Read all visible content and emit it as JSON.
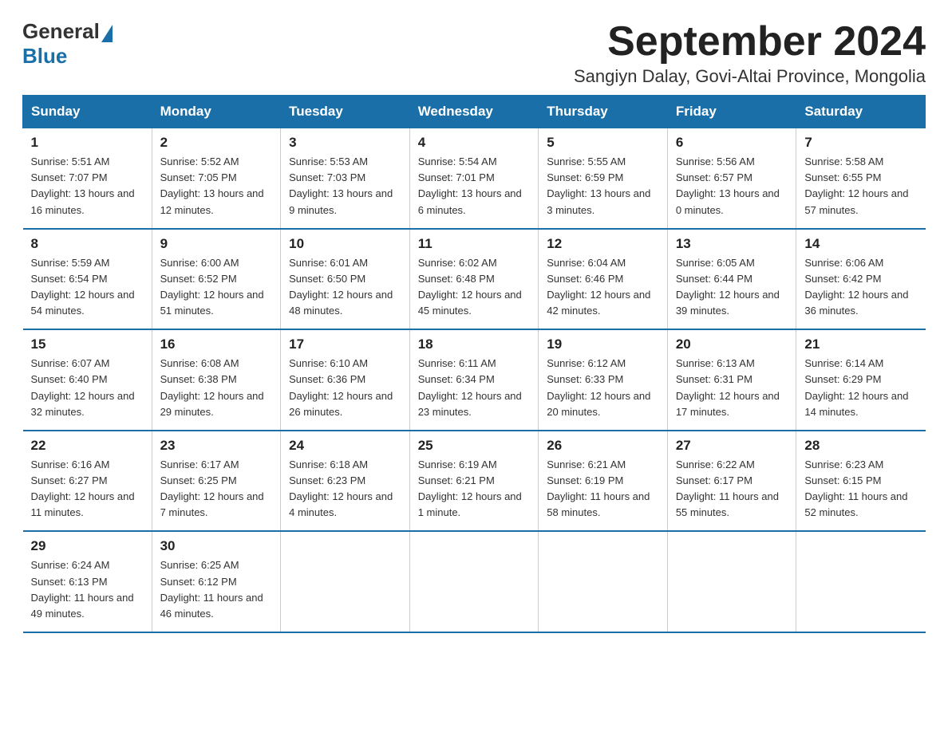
{
  "logo": {
    "general": "General",
    "blue": "Blue"
  },
  "header": {
    "month_year": "September 2024",
    "location": "Sangiyn Dalay, Govi-Altai Province, Mongolia"
  },
  "days_of_week": [
    "Sunday",
    "Monday",
    "Tuesday",
    "Wednesday",
    "Thursday",
    "Friday",
    "Saturday"
  ],
  "weeks": [
    [
      {
        "day": "1",
        "sunrise": "5:51 AM",
        "sunset": "7:07 PM",
        "daylight": "13 hours and 16 minutes."
      },
      {
        "day": "2",
        "sunrise": "5:52 AM",
        "sunset": "7:05 PM",
        "daylight": "13 hours and 12 minutes."
      },
      {
        "day": "3",
        "sunrise": "5:53 AM",
        "sunset": "7:03 PM",
        "daylight": "13 hours and 9 minutes."
      },
      {
        "day": "4",
        "sunrise": "5:54 AM",
        "sunset": "7:01 PM",
        "daylight": "13 hours and 6 minutes."
      },
      {
        "day": "5",
        "sunrise": "5:55 AM",
        "sunset": "6:59 PM",
        "daylight": "13 hours and 3 minutes."
      },
      {
        "day": "6",
        "sunrise": "5:56 AM",
        "sunset": "6:57 PM",
        "daylight": "13 hours and 0 minutes."
      },
      {
        "day": "7",
        "sunrise": "5:58 AM",
        "sunset": "6:55 PM",
        "daylight": "12 hours and 57 minutes."
      }
    ],
    [
      {
        "day": "8",
        "sunrise": "5:59 AM",
        "sunset": "6:54 PM",
        "daylight": "12 hours and 54 minutes."
      },
      {
        "day": "9",
        "sunrise": "6:00 AM",
        "sunset": "6:52 PM",
        "daylight": "12 hours and 51 minutes."
      },
      {
        "day": "10",
        "sunrise": "6:01 AM",
        "sunset": "6:50 PM",
        "daylight": "12 hours and 48 minutes."
      },
      {
        "day": "11",
        "sunrise": "6:02 AM",
        "sunset": "6:48 PM",
        "daylight": "12 hours and 45 minutes."
      },
      {
        "day": "12",
        "sunrise": "6:04 AM",
        "sunset": "6:46 PM",
        "daylight": "12 hours and 42 minutes."
      },
      {
        "day": "13",
        "sunrise": "6:05 AM",
        "sunset": "6:44 PM",
        "daylight": "12 hours and 39 minutes."
      },
      {
        "day": "14",
        "sunrise": "6:06 AM",
        "sunset": "6:42 PM",
        "daylight": "12 hours and 36 minutes."
      }
    ],
    [
      {
        "day": "15",
        "sunrise": "6:07 AM",
        "sunset": "6:40 PM",
        "daylight": "12 hours and 32 minutes."
      },
      {
        "day": "16",
        "sunrise": "6:08 AM",
        "sunset": "6:38 PM",
        "daylight": "12 hours and 29 minutes."
      },
      {
        "day": "17",
        "sunrise": "6:10 AM",
        "sunset": "6:36 PM",
        "daylight": "12 hours and 26 minutes."
      },
      {
        "day": "18",
        "sunrise": "6:11 AM",
        "sunset": "6:34 PM",
        "daylight": "12 hours and 23 minutes."
      },
      {
        "day": "19",
        "sunrise": "6:12 AM",
        "sunset": "6:33 PM",
        "daylight": "12 hours and 20 minutes."
      },
      {
        "day": "20",
        "sunrise": "6:13 AM",
        "sunset": "6:31 PM",
        "daylight": "12 hours and 17 minutes."
      },
      {
        "day": "21",
        "sunrise": "6:14 AM",
        "sunset": "6:29 PM",
        "daylight": "12 hours and 14 minutes."
      }
    ],
    [
      {
        "day": "22",
        "sunrise": "6:16 AM",
        "sunset": "6:27 PM",
        "daylight": "12 hours and 11 minutes."
      },
      {
        "day": "23",
        "sunrise": "6:17 AM",
        "sunset": "6:25 PM",
        "daylight": "12 hours and 7 minutes."
      },
      {
        "day": "24",
        "sunrise": "6:18 AM",
        "sunset": "6:23 PM",
        "daylight": "12 hours and 4 minutes."
      },
      {
        "day": "25",
        "sunrise": "6:19 AM",
        "sunset": "6:21 PM",
        "daylight": "12 hours and 1 minute."
      },
      {
        "day": "26",
        "sunrise": "6:21 AM",
        "sunset": "6:19 PM",
        "daylight": "11 hours and 58 minutes."
      },
      {
        "day": "27",
        "sunrise": "6:22 AM",
        "sunset": "6:17 PM",
        "daylight": "11 hours and 55 minutes."
      },
      {
        "day": "28",
        "sunrise": "6:23 AM",
        "sunset": "6:15 PM",
        "daylight": "11 hours and 52 minutes."
      }
    ],
    [
      {
        "day": "29",
        "sunrise": "6:24 AM",
        "sunset": "6:13 PM",
        "daylight": "11 hours and 49 minutes."
      },
      {
        "day": "30",
        "sunrise": "6:25 AM",
        "sunset": "6:12 PM",
        "daylight": "11 hours and 46 minutes."
      },
      null,
      null,
      null,
      null,
      null
    ]
  ]
}
